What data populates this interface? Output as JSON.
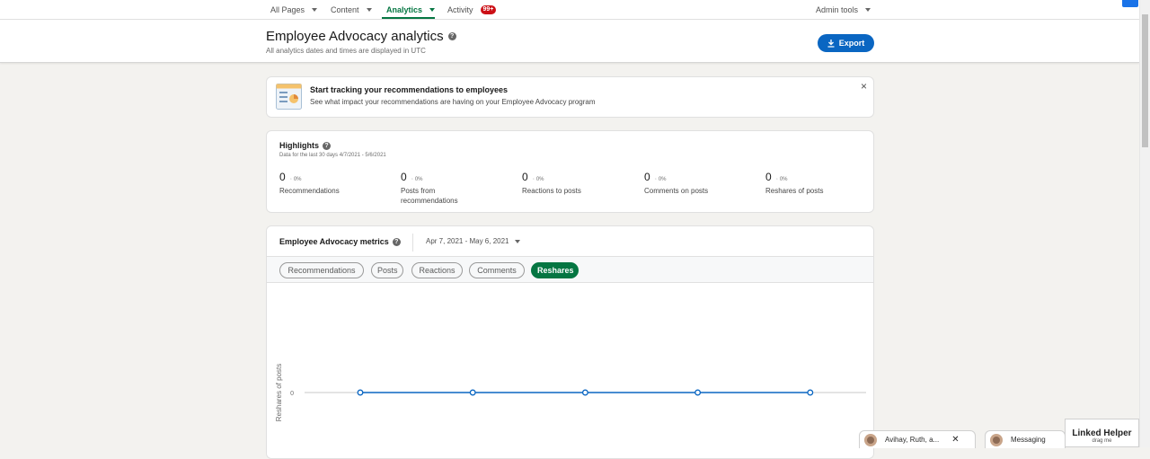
{
  "nav": {
    "items": [
      {
        "label": "All Pages"
      },
      {
        "label": "Content"
      },
      {
        "label": "Analytics"
      },
      {
        "label": "Activity",
        "badge": "99+"
      }
    ],
    "admin_tools": "Admin tools"
  },
  "header": {
    "title": "Employee Advocacy analytics",
    "subtitle": "All analytics dates and times are displayed in UTC",
    "export_label": "Export"
  },
  "banner": {
    "title": "Start tracking your recommendations to employees",
    "description": "See what impact your recommendations are having on your Employee Advocacy program",
    "close_icon": "×"
  },
  "highlights": {
    "title": "Highlights",
    "range": "Data for the last 30 days 4/7/2021 - 5/6/2021",
    "metrics": [
      {
        "value": "0",
        "change": "0%",
        "label": "Recommendations"
      },
      {
        "value": "0",
        "change": "0%",
        "label": "Posts from recommendations"
      },
      {
        "value": "0",
        "change": "0%",
        "label": "Reactions to posts"
      },
      {
        "value": "0",
        "change": "0%",
        "label": "Comments on posts"
      },
      {
        "value": "0",
        "change": "0%",
        "label": "Reshares of posts"
      }
    ]
  },
  "metrics_panel": {
    "title": "Employee Advocacy metrics",
    "date_range": "Apr 7, 2021 - May 6, 2021",
    "pills": [
      {
        "label": "Recommendations",
        "active": false
      },
      {
        "label": "Posts",
        "active": false
      },
      {
        "label": "Reactions",
        "active": false
      },
      {
        "label": "Comments",
        "active": false
      },
      {
        "label": "Reshares",
        "active": true
      }
    ]
  },
  "chart_data": {
    "type": "line",
    "title": "",
    "xlabel": "",
    "ylabel": "Reshares of posts",
    "y_ticks": [
      "0"
    ],
    "values": [
      0,
      0,
      0,
      0,
      0
    ],
    "color": "#0a66c2",
    "grid": false
  },
  "bottom": {
    "chat_label": "Avihay, Ruth, a...",
    "close_icon": "✕",
    "messaging_label": "Messaging",
    "linked_helper_title": "Linked Helper",
    "linked_helper_sub": "drag me"
  },
  "colors": {
    "accent_green": "#057642",
    "primary_blue": "#0a66c2",
    "badge_red": "#cc1016"
  }
}
